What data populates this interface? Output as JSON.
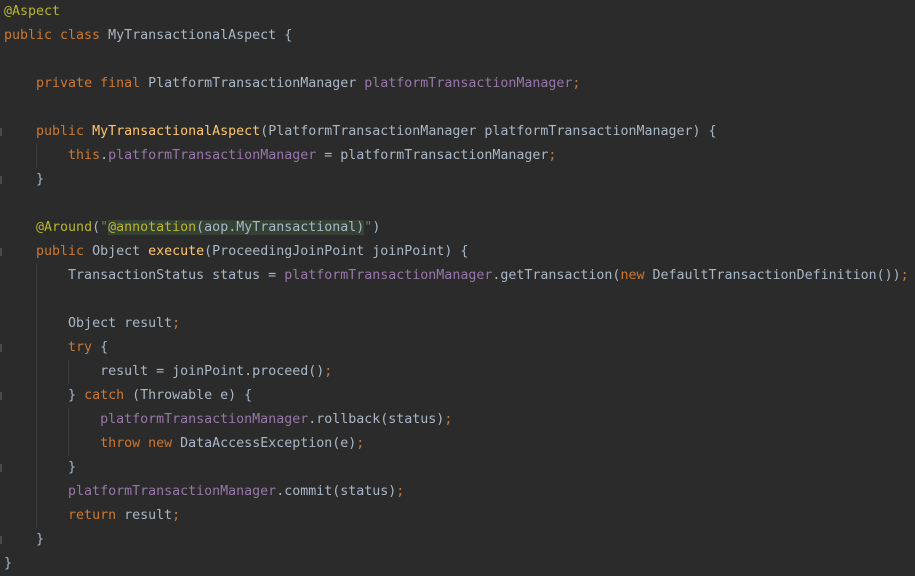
{
  "editor": {
    "language": "java",
    "colors": {
      "background": "#2b2b2b",
      "keyword": "#cc7832",
      "annotation": "#bbb529",
      "field": "#9876aa",
      "method": "#ffc66d",
      "string": "#6a8759",
      "text": "#a9b7c6"
    },
    "lines": [
      [
        {
          "t": "@Aspect",
          "c": "ann"
        }
      ],
      [
        {
          "t": "public class ",
          "c": "kw"
        },
        {
          "t": "MyTransactionalAspect {",
          "c": "plain"
        }
      ],
      [],
      [
        {
          "t": "    "
        },
        {
          "t": "private final ",
          "c": "kw"
        },
        {
          "t": "PlatformTransactionManager ",
          "c": "plain"
        },
        {
          "t": "platformTransactionManager",
          "c": "fld"
        },
        {
          "t": ";",
          "c": "kw"
        }
      ],
      [],
      [
        {
          "t": "    "
        },
        {
          "t": "public ",
          "c": "kw"
        },
        {
          "t": "MyTransactionalAspect",
          "c": "mth"
        },
        {
          "t": "(PlatformTransactionManager platformTransactionManager) {",
          "c": "plain"
        }
      ],
      [
        {
          "t": "        "
        },
        {
          "t": "this",
          "c": "kw"
        },
        {
          "t": ".",
          "c": "plain"
        },
        {
          "t": "platformTransactionManager",
          "c": "fld"
        },
        {
          "t": " = platformTransactionManager",
          "c": "plain"
        },
        {
          "t": ";",
          "c": "kw"
        }
      ],
      [
        {
          "t": "    }",
          "c": "plain"
        }
      ],
      [],
      [
        {
          "t": "    "
        },
        {
          "t": "@Around",
          "c": "ann"
        },
        {
          "t": "(",
          "c": "plain"
        },
        {
          "t": "\"",
          "c": "str"
        },
        {
          "t": "@annotation",
          "c": "ann",
          "inj": true
        },
        {
          "t": "(aop.MyTransactional)",
          "c": "plain",
          "inj": true
        },
        {
          "t": "\"",
          "c": "str"
        },
        {
          "t": ")",
          "c": "plain"
        }
      ],
      [
        {
          "t": "    "
        },
        {
          "t": "public ",
          "c": "kw"
        },
        {
          "t": "Object ",
          "c": "plain"
        },
        {
          "t": "execute",
          "c": "mth"
        },
        {
          "t": "(ProceedingJoinPoint joinPoint) {",
          "c": "plain"
        }
      ],
      [
        {
          "t": "        "
        },
        {
          "t": "TransactionStatus status = ",
          "c": "plain"
        },
        {
          "t": "platformTransactionManager",
          "c": "fld"
        },
        {
          "t": ".getTransaction(",
          "c": "plain"
        },
        {
          "t": "new ",
          "c": "kw"
        },
        {
          "t": "DefaultTransactionDefinition())",
          "c": "plain"
        },
        {
          "t": ";",
          "c": "kw"
        }
      ],
      [],
      [
        {
          "t": "        "
        },
        {
          "t": "Object result",
          "c": "plain"
        },
        {
          "t": ";",
          "c": "kw"
        }
      ],
      [
        {
          "t": "        "
        },
        {
          "t": "try ",
          "c": "kw"
        },
        {
          "t": "{",
          "c": "plain"
        }
      ],
      [
        {
          "t": "            "
        },
        {
          "t": "result = joinPoint.proceed()",
          "c": "plain"
        },
        {
          "t": ";",
          "c": "kw"
        }
      ],
      [
        {
          "t": "        "
        },
        {
          "t": "} ",
          "c": "plain"
        },
        {
          "t": "catch ",
          "c": "kw"
        },
        {
          "t": "(Throwable e) {",
          "c": "plain"
        }
      ],
      [
        {
          "t": "            "
        },
        {
          "t": "platformTransactionManager",
          "c": "fld"
        },
        {
          "t": ".rollback(status)",
          "c": "plain"
        },
        {
          "t": ";",
          "c": "kw"
        }
      ],
      [
        {
          "t": "            "
        },
        {
          "t": "throw new ",
          "c": "kw"
        },
        {
          "t": "DataAccessException(e)",
          "c": "plain"
        },
        {
          "t": ";",
          "c": "kw"
        }
      ],
      [
        {
          "t": "        }",
          "c": "plain"
        }
      ],
      [
        {
          "t": "        "
        },
        {
          "t": "platformTransactionManager",
          "c": "fld"
        },
        {
          "t": ".commit(status)",
          "c": "plain"
        },
        {
          "t": ";",
          "c": "kw"
        }
      ],
      [
        {
          "t": "        "
        },
        {
          "t": "return ",
          "c": "kw"
        },
        {
          "t": "result",
          "c": "plain"
        },
        {
          "t": ";",
          "c": "kw"
        }
      ],
      [
        {
          "t": "    }",
          "c": "plain"
        }
      ],
      [
        {
          "t": "}",
          "c": "plain"
        }
      ]
    ]
  }
}
